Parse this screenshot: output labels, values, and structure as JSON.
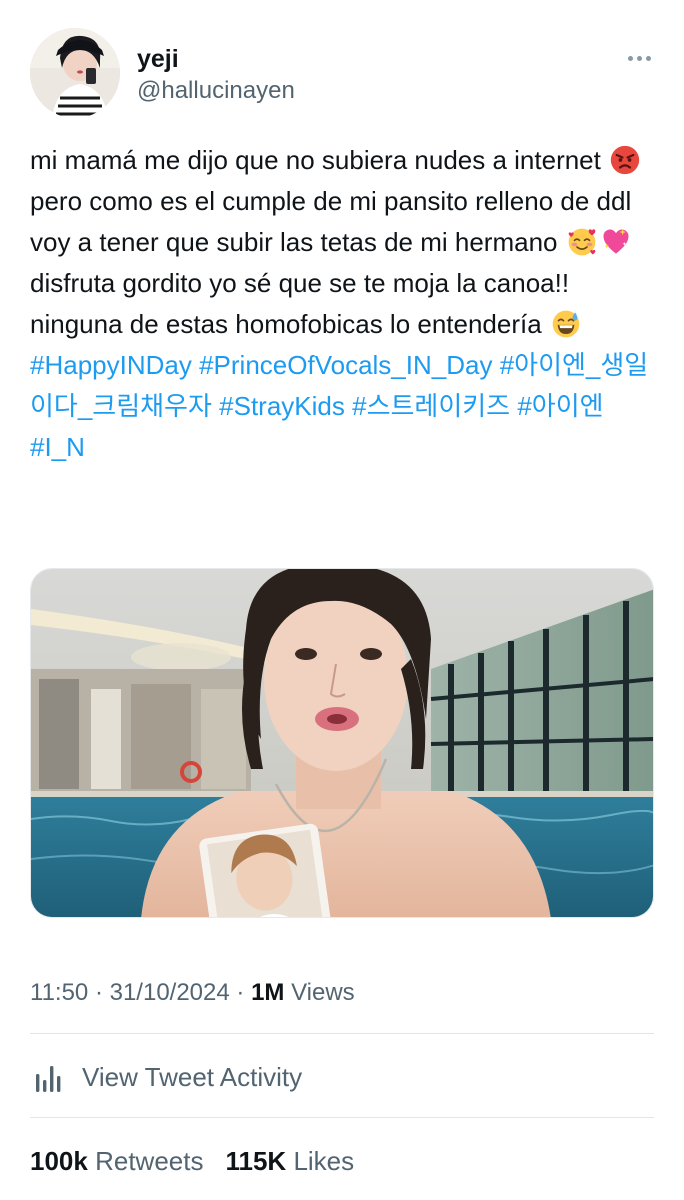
{
  "author": {
    "display_name": "yeji",
    "handle": "@hallucinayen"
  },
  "tweet": {
    "text_parts": {
      "p1": "mi mamá me dijo que no subiera nudes a internet ",
      "p2": " pero como es el cumple de mi pansito relleno de ddl voy a tener que subir las tetas de mi hermano ",
      "p3": " disfruta gordito yo sé que se te moja la canoa!! ninguna de estas homofobicas lo entendería ",
      "emoji_1": "angry-face-icon",
      "emoji_2": "smiling-hearts-face-icon",
      "emoji_3": "sparkling-heart-icon",
      "emoji_4": "grinning-sweat-face-icon"
    },
    "hashtags": [
      "#HappyINDay",
      "#PrinceOfVocals_IN_Day",
      "#아이엔_생일이다_크림채우자",
      "#StrayKids",
      "#스트레이키즈",
      "#아이엔",
      "#I_N"
    ]
  },
  "meta": {
    "time": "11:50",
    "separator": " · ",
    "date": "31/10/2024",
    "views_count": "1M",
    "views_label": "Views"
  },
  "activity": {
    "label": "View Tweet Activity",
    "icon": "bar-chart-icon"
  },
  "stats": {
    "retweets_count": "100k",
    "retweets_label": "Retweets",
    "likes_count": "115K",
    "likes_label": "Likes"
  },
  "colors": {
    "link": "#1d9bf0",
    "secondary_text": "#536471",
    "primary_text": "#0f1419",
    "divider": "#dfe5e9"
  }
}
